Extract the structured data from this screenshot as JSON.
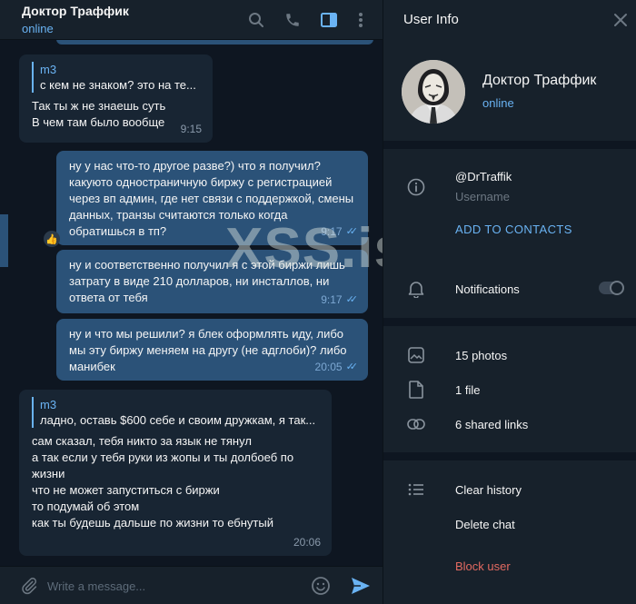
{
  "chat": {
    "title": "Доктор Траффик",
    "status": "online",
    "header_icons": [
      "search-icon",
      "phone-icon",
      "sidebar-toggle-icon",
      "more-vertical-icon"
    ]
  },
  "messages": [
    {
      "direction": "in",
      "reply_name": "m3",
      "reply_text": "с кем не знаком? это на те...",
      "text": "Так ты ж не знаешь суть\nВ чем там было вообще",
      "time": "9:15"
    },
    {
      "direction": "out",
      "text": "ну у нас что-то другое разве?) что я получил?\nкакуюто одностраничную биржу с регистрацией через вп админ, где нет связи с поддержкой, смены данных, транзы считаются только когда обратишься в тп?",
      "time": "9:17",
      "reaction": "👍"
    },
    {
      "direction": "out",
      "text": "ну и соответственно получил я с этой биржи лишь затрату в виде 210 долларов, ни инсталлов, ни ответа от тебя",
      "time": "9:17"
    },
    {
      "direction": "out",
      "text": "ну и что мы решили? я блек оформлять иду, либо мы эту биржу меняем на другу (не адглоби)? либо манибек",
      "time": "20:05"
    },
    {
      "direction": "in",
      "reply_name": "m3",
      "reply_text": "ладно, оставь $600 себе и своим дружкам, я так...",
      "text": "сам сказал, тебя никто за язык не тянул\nа так если у тебя руки из жопы и ты долбоеб по жизни\nчто не может запуститься с биржи\nто подумай об этом\nкак ты будешь дальше по жизни то ебнутый",
      "time": "20:06"
    }
  ],
  "watermark": "XSS.is",
  "composer": {
    "placeholder": "Write a message...",
    "icons": [
      "attach-icon",
      "emoji-icon",
      "send-icon"
    ]
  },
  "user_info": {
    "title": "User Info",
    "name": "Доктор Траффик",
    "status": "online",
    "username": "@DrTraffik",
    "username_label": "Username",
    "add_to_contacts": "ADD TO CONTACTS",
    "notifications_label": "Notifications",
    "notifications_enabled": false,
    "media": {
      "photos": "15 photos",
      "files": "1 file",
      "links": "6 shared links"
    },
    "actions": {
      "clear_history": "Clear history",
      "delete_chat": "Delete chat",
      "block_user": "Block user"
    }
  },
  "colors": {
    "accent": "#6ab3f3",
    "danger": "#e36a61",
    "outgoing_bubble": "#2b5278",
    "incoming_bubble": "#182533",
    "panel": "#17212b",
    "background": "#0e1621"
  }
}
